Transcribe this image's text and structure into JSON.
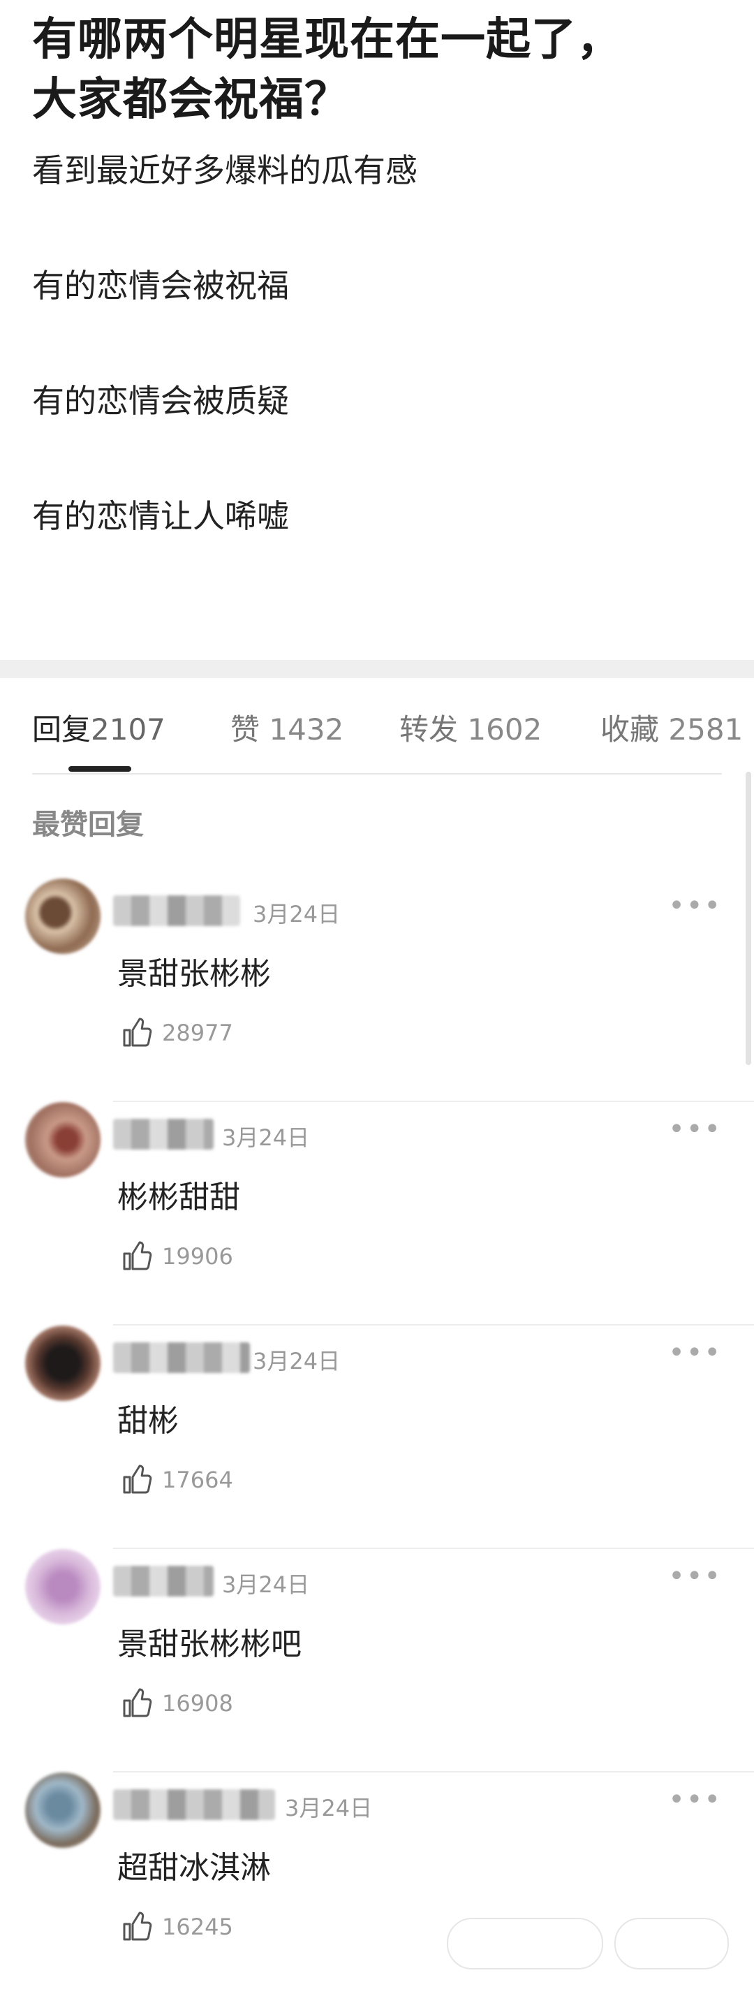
{
  "post": {
    "title_line1": "有哪两个明星现在在一起了，",
    "title_line2": "大家都会祝福？",
    "lines": [
      "看到最近好多爆料的瓜有感",
      "有的恋情会被祝福",
      "有的恋情会被质疑",
      "有的恋情让人唏嘘"
    ]
  },
  "tabs": [
    {
      "label": "回复",
      "count": "2107"
    },
    {
      "label": "赞",
      "count": "1432"
    },
    {
      "label": "转发",
      "count": "1602"
    },
    {
      "label": "收藏",
      "count": "2581"
    }
  ],
  "section_label": "最赞回复",
  "comments": [
    {
      "date": "3月24日",
      "text": "景甜张彬彬",
      "likes": "28977"
    },
    {
      "date": "3月24日",
      "text": "彬彬甜甜",
      "likes": "19906"
    },
    {
      "date": "3月24日",
      "text": "甜彬",
      "likes": "17664"
    },
    {
      "date": "3月24日",
      "text": "景甜张彬彬吧",
      "likes": "16908"
    },
    {
      "date": "3月24日",
      "text": "超甜冰淇淋",
      "likes": "16245"
    }
  ],
  "icons": {
    "more": "more-horizontal-icon",
    "like": "thumbs-up-icon"
  },
  "more_glyph": "•••"
}
